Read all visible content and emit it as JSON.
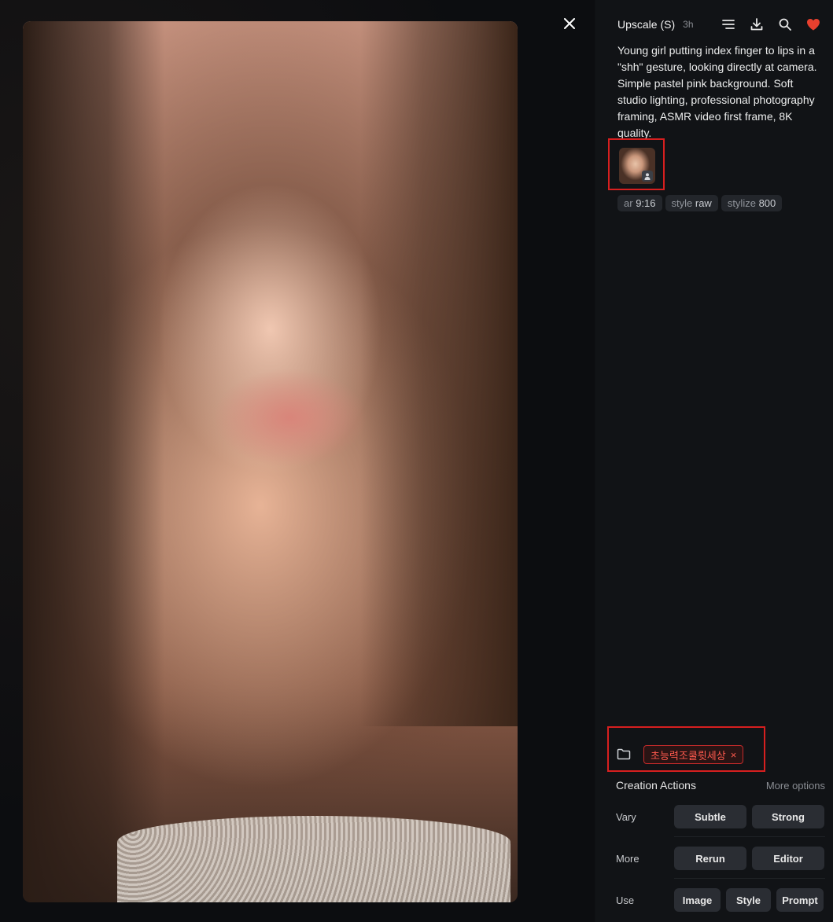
{
  "header": {
    "title": "Upscale (S)",
    "time": "3h"
  },
  "prompt": "Young girl putting index finger to lips in a \"shh\" gesture, looking directly at camera. Simple pastel pink background. Soft studio lighting, professional photography framing, ASMR video first frame, 8K quality.",
  "parameters": [
    {
      "key": "ar",
      "value": "9:16"
    },
    {
      "key": "style",
      "value": "raw"
    },
    {
      "key": "stylize",
      "value": "800"
    }
  ],
  "folder": {
    "name": "초능력조쿨륏세상",
    "remove": "×"
  },
  "creation_actions": {
    "title": "Creation Actions",
    "more_options": "More options",
    "vary": {
      "label": "Vary",
      "subtle": "Subtle",
      "strong": "Strong"
    },
    "more": {
      "label": "More",
      "rerun": "Rerun",
      "editor": "Editor"
    },
    "use": {
      "label": "Use",
      "image": "Image",
      "style": "Style",
      "prompt": "Prompt"
    }
  },
  "colors": {
    "accent_red": "#e8402e",
    "panel_bg": "#111316",
    "button_bg": "#2a2d33"
  },
  "icons": [
    "close-icon",
    "options-icon",
    "download-icon",
    "search-icon",
    "heart-icon",
    "folder-icon",
    "person-icon"
  ]
}
